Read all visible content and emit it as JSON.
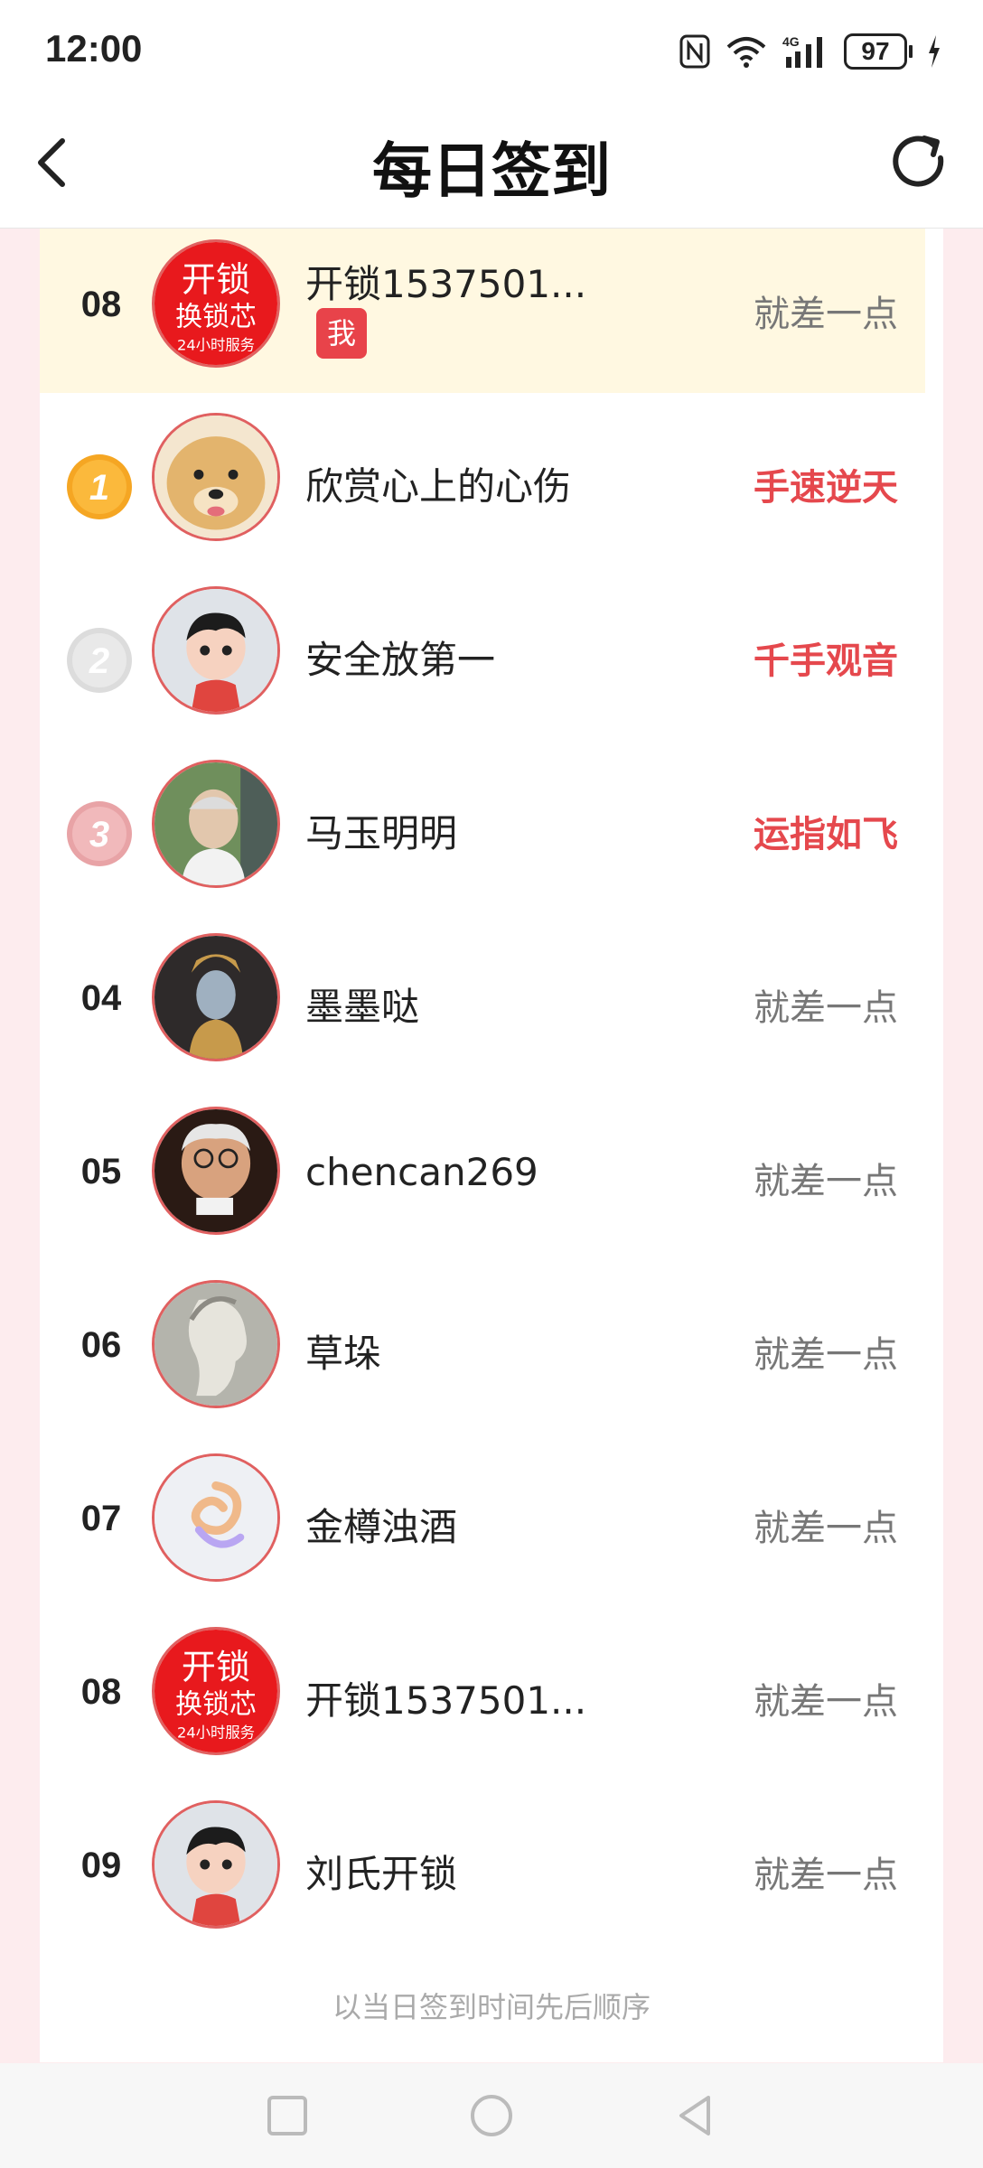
{
  "status_bar": {
    "time": "12:00",
    "battery": "97"
  },
  "header": {
    "title": "每日签到"
  },
  "me_row": {
    "rank": "08",
    "name": "开锁1537501...",
    "badge": "我",
    "title": "就差一点"
  },
  "rows": [
    {
      "rank": "1",
      "name": "欣赏心上的心伤",
      "title": "手速逆天",
      "hot": true
    },
    {
      "rank": "2",
      "name": "安全放第一",
      "title": "千手观音",
      "hot": true
    },
    {
      "rank": "3",
      "name": "马玉明明",
      "title": "运指如飞",
      "hot": true
    },
    {
      "rank": "04",
      "name": "墨墨哒",
      "title": "就差一点",
      "hot": false
    },
    {
      "rank": "05",
      "name": "chencan269",
      "title": "就差一点",
      "hot": false
    },
    {
      "rank": "06",
      "name": "草垛",
      "title": "就差一点",
      "hot": false
    },
    {
      "rank": "07",
      "name": "金樽浊酒",
      "title": "就差一点",
      "hot": false
    },
    {
      "rank": "08",
      "name": "开锁1537501...",
      "title": "就差一点",
      "hot": false
    },
    {
      "rank": "09",
      "name": "刘氏开锁",
      "title": "就差一点",
      "hot": false
    }
  ],
  "footer": {
    "note": "以当日签到时间先后顺序"
  },
  "colors": {
    "accent": "#e5484d",
    "gold": "#f5a623",
    "silver": "#d9d9d9",
    "bronze": "#e8a3a6"
  },
  "icons": [
    "back-arrow-icon",
    "refresh-icon",
    "nfc-icon",
    "wifi-icon",
    "signal-icon",
    "battery-icon",
    "charging-icon",
    "square-nav-icon",
    "circle-nav-icon",
    "triangle-nav-icon"
  ]
}
